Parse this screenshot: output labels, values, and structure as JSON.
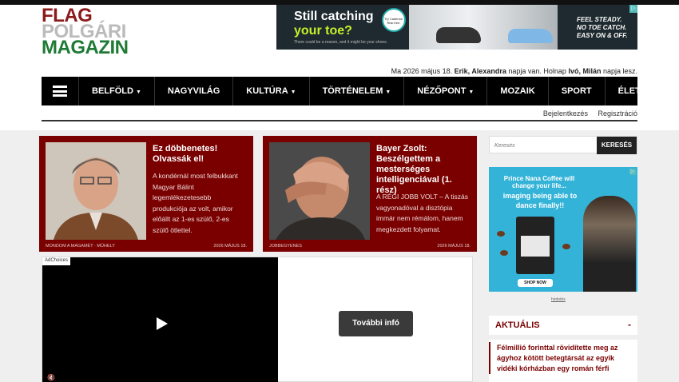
{
  "logo": {
    "line1": "FLAG",
    "line2": "POLGÁRI",
    "line3": "MAGAZIN"
  },
  "top_ad": {
    "headline1": "Still catching",
    "headline2": "your toe?",
    "fine_print": "There could be a reason, and it might be your shoes.",
    "badge": "Try Cadence. Risk free.",
    "tagline1": "FEEL STEADY.",
    "tagline2": "NO TOE CATCH.",
    "tagline3": "EASY ON & OFF."
  },
  "dateline": {
    "prefix": "Ma 2026 május 18.",
    "names_today": "Erik, Alexandra",
    "middle": "napja van. Holnap",
    "names_tomorrow": "Ivó, Milán",
    "suffix": "napja lesz."
  },
  "nav": {
    "menu_icon": "hamburger-icon",
    "items": [
      {
        "label": "BELFÖLD",
        "dropdown": true
      },
      {
        "label": "NAGYVILÁG",
        "dropdown": false
      },
      {
        "label": "KULTÚRA",
        "dropdown": true
      },
      {
        "label": "TÖRTÉNELEM",
        "dropdown": true
      },
      {
        "label": "NÉZŐPONT",
        "dropdown": true
      },
      {
        "label": "MOZAIK",
        "dropdown": false
      },
      {
        "label": "SPORT",
        "dropdown": false
      },
      {
        "label": "ÉLETMÓD",
        "dropdown": true
      }
    ],
    "caret": "▼"
  },
  "auth": {
    "login": "Bejelentkezés",
    "register": "Regisztráció"
  },
  "cards": [
    {
      "title": "Ez döbbenetes! Olvassák el!",
      "excerpt": "A kondérnál most felbukkant Magyar Bálint legemlékezetesebb produkciója az volt, amikor előállt az 1-es szülő, 2-es szülő ötlettel.",
      "category": "MONDOM A MAGAMÉT · MŰHELY",
      "date": "2026 MÁJUS 18."
    },
    {
      "title": "Bayer Zsolt: Beszélgettem a mesterséges intelligenciával (1. rész)",
      "excerpt": "A RÉGI JOBB VOLT – A tiszás vagyonadóval a disztópia immár nem rémálom, hanem megkezdett folyamat.",
      "category": "JOBBEGYENES",
      "date": "2026 MÁJUS 18."
    }
  ],
  "video": {
    "adchoices": "AdChoices",
    "more_info": "További infó"
  },
  "search": {
    "placeholder": "Keresés",
    "button": "KERESÉS"
  },
  "side_ad": {
    "brand": "Prince Nana Coffee will change your life...",
    "headline": "imaging being able to dance finally!!",
    "cta": "SHOP NOW",
    "caption": "hirdetés"
  },
  "aktualis": {
    "label": "AKTUÁLIS",
    "toggle": "-",
    "headline": "Félmillió forinttal rövidítette meg az ágyhoz kötött betegtársát az egyik vidéki kórházban egy román férfi"
  },
  "colors": {
    "brand_red": "#7a0000",
    "nav_bg": "#000000"
  }
}
